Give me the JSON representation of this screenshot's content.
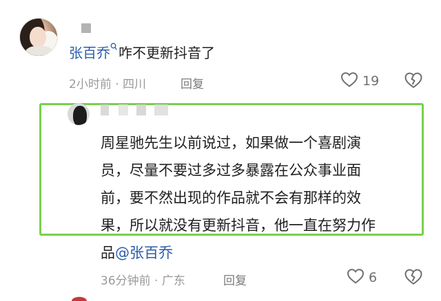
{
  "comment": {
    "user_name": "张百乔",
    "text": "咋不更新抖音了",
    "time": "2小时前",
    "separator": " · ",
    "location": "四川",
    "reply_label": "回复",
    "like_count": "19",
    "icons": {
      "search": "search-icon",
      "like": "heart-icon",
      "dislike": "broken-heart-icon"
    }
  },
  "reply": {
    "lines": [
      "周星驰先生以前说过，如果做一个喜剧演",
      "员，尽量不要过多过多暴露在公众事业面",
      "前，要不然出现的作品就不会有那样的效",
      "果，所以就没有更新抖音，他一直在努力作"
    ],
    "last_line_prefix": "品",
    "mention": "@张百乔",
    "time": "36分钟前",
    "separator": " · ",
    "location": "广东",
    "reply_label": "回复",
    "like_count": "6"
  },
  "colors": {
    "highlight_border": "#78d04c",
    "mention": "#2b5cab",
    "meta": "#9a9a9a"
  }
}
